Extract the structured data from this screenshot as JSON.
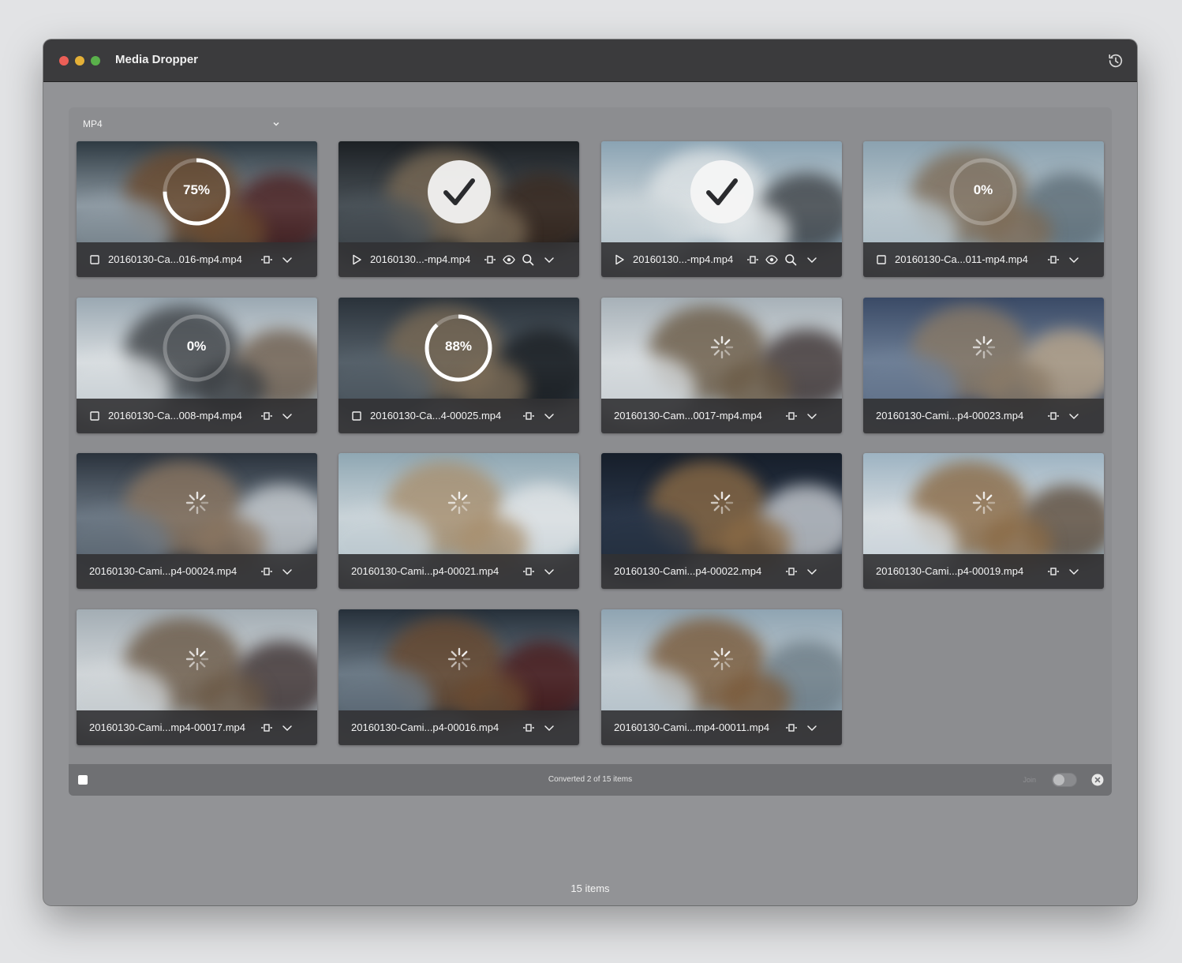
{
  "app": {
    "title": "Media Dropper"
  },
  "format": {
    "selected": "MP4"
  },
  "status": {
    "text": "Converted 2 of 15 items",
    "join_label": "Join"
  },
  "footer": {
    "count": "15 items"
  },
  "colors": {
    "window_bg": "#929396",
    "titlebar": "#3b3b3d",
    "statusbar": "#6f7073",
    "infobar": "#2d2d30"
  },
  "cards": [
    {
      "filename": "20160130-Ca...016-mp4.mp4",
      "state": "progress",
      "progress": 0.75,
      "progress_label": "75%",
      "lead_icon": "stop-icon",
      "actions": [
        "trim-icon",
        "chevron-down-icon"
      ],
      "palette": [
        "#2e3a42",
        "#8e9aa3",
        "#6b4a2e",
        "#4a1e1e"
      ]
    },
    {
      "filename": "20160130...-mp4.mp4",
      "state": "done",
      "lead_icon": "play-icon",
      "actions": [
        "trim-icon",
        "eye-icon",
        "search-icon",
        "chevron-down-icon"
      ],
      "palette": [
        "#1c2024",
        "#4a5258",
        "#7a6a55",
        "#3a2a20"
      ]
    },
    {
      "filename": "20160130...-mp4.mp4",
      "state": "done",
      "lead_icon": "play-icon",
      "actions": [
        "trim-icon",
        "eye-icon",
        "search-icon",
        "chevron-down-icon"
      ],
      "palette": [
        "#8aa3b3",
        "#c7d1d6",
        "#dfe4e6",
        "#3a3f44"
      ]
    },
    {
      "filename": "20160130-Ca...011-mp4.mp4",
      "state": "progress",
      "progress": 0.0,
      "progress_label": "0%",
      "lead_icon": "stop-icon",
      "actions": [
        "trim-icon",
        "chevron-down-icon"
      ],
      "palette": [
        "#8ba2b0",
        "#b9c6cd",
        "#7c6a55",
        "#5a6a74"
      ]
    },
    {
      "filename": "20160130-Ca...008-mp4.mp4",
      "state": "progress",
      "progress": 0.0,
      "progress_label": "0%",
      "lead_icon": "stop-icon",
      "actions": [
        "trim-icon",
        "chevron-down-icon"
      ],
      "palette": [
        "#9aa8b2",
        "#d8dde0",
        "#3a3e42",
        "#6a5a4a"
      ]
    },
    {
      "filename": "20160130-Ca...4-00025.mp4",
      "state": "progress",
      "progress": 0.88,
      "progress_label": "88%",
      "lead_icon": "stop-icon",
      "actions": [
        "trim-icon",
        "chevron-down-icon"
      ],
      "palette": [
        "#2a323a",
        "#56616a",
        "#7a6a55",
        "#1a1e22"
      ]
    },
    {
      "filename": "20160130-Cam...0017-mp4.mp4",
      "state": "queued",
      "actions": [
        "trim-icon",
        "chevron-down-icon"
      ],
      "palette": [
        "#a7b1b8",
        "#d6dbde",
        "#6a5a45",
        "#3a3030"
      ]
    },
    {
      "filename": "20160130-Cami...p4-00023.mp4",
      "state": "queued",
      "actions": [
        "trim-icon",
        "chevron-down-icon"
      ],
      "palette": [
        "#3a4a66",
        "#6e7f96",
        "#8a7a66",
        "#b9a58a"
      ]
    },
    {
      "filename": "20160130-Cami...p4-00024.mp4",
      "state": "queued",
      "actions": [
        "trim-icon",
        "chevron-down-icon"
      ],
      "palette": [
        "#2a323c",
        "#6c7884",
        "#8a7560",
        "#c9ced2"
      ]
    },
    {
      "filename": "20160130-Cami...p4-00021.mp4",
      "state": "queued",
      "actions": [
        "trim-icon",
        "chevron-down-icon"
      ],
      "palette": [
        "#8fa7b3",
        "#c9d3d8",
        "#a88f6e",
        "#e0e4e6"
      ]
    },
    {
      "filename": "20160130-Cami...p4-00022.mp4",
      "state": "queued",
      "actions": [
        "trim-icon",
        "chevron-down-icon"
      ],
      "palette": [
        "#161e2a",
        "#2a3648",
        "#8a6a45",
        "#c9cdd2"
      ]
    },
    {
      "filename": "20160130-Cami...p4-00019.mp4",
      "state": "queued",
      "actions": [
        "trim-icon",
        "chevron-down-icon"
      ],
      "palette": [
        "#9db3c2",
        "#d7dde1",
        "#8a6a45",
        "#5a4a3a"
      ]
    },
    {
      "filename": "20160130-Cami...mp4-00017.mp4",
      "state": "queued",
      "actions": [
        "trim-icon",
        "chevron-down-icon"
      ],
      "palette": [
        "#a3adb4",
        "#d0d5d8",
        "#6a5845",
        "#3a2e2e"
      ]
    },
    {
      "filename": "20160130-Cami...p4-00016.mp4",
      "state": "queued",
      "actions": [
        "trim-icon",
        "chevron-down-icon"
      ],
      "palette": [
        "#26303a",
        "#6c7a86",
        "#6a4a30",
        "#4a1a1a"
      ]
    },
    {
      "filename": "20160130-Cami...mp4-00011.mp4",
      "state": "queued",
      "actions": [
        "trim-icon",
        "chevron-down-icon"
      ],
      "palette": [
        "#8fa4b2",
        "#c2ccd2",
        "#7a5a3a",
        "#6a7a84"
      ]
    }
  ]
}
